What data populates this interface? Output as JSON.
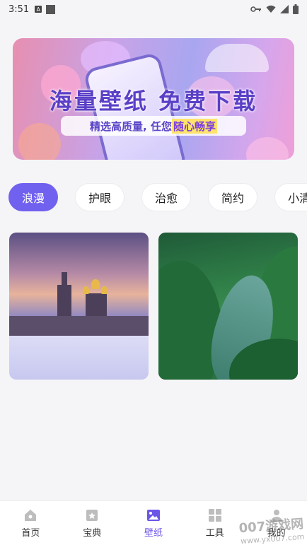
{
  "status_bar": {
    "time": "3:51",
    "badge_letter": "A"
  },
  "banner": {
    "headline": "海量壁纸 免费下载",
    "sub_prefix": "精选高质量, 任您",
    "sub_highlight": "随心畅享"
  },
  "tabs": [
    {
      "label": "浪漫",
      "active": true
    },
    {
      "label": "护眼",
      "active": false
    },
    {
      "label": "治愈",
      "active": false
    },
    {
      "label": "简约",
      "active": false
    },
    {
      "label": "小清",
      "active": false
    }
  ],
  "nav": {
    "items": [
      {
        "label": "首页",
        "icon": "home-icon"
      },
      {
        "label": "宝典",
        "icon": "book-icon"
      },
      {
        "label": "壁纸",
        "icon": "image-icon",
        "active": true
      },
      {
        "label": "工具",
        "icon": "grid-icon"
      },
      {
        "label": "我的",
        "icon": "user-icon"
      }
    ]
  },
  "watermark": {
    "text": "007游戏网",
    "url": "www.yx007.com"
  },
  "colors": {
    "accent": "#7161ef",
    "nav_active": "#6a55e8"
  }
}
